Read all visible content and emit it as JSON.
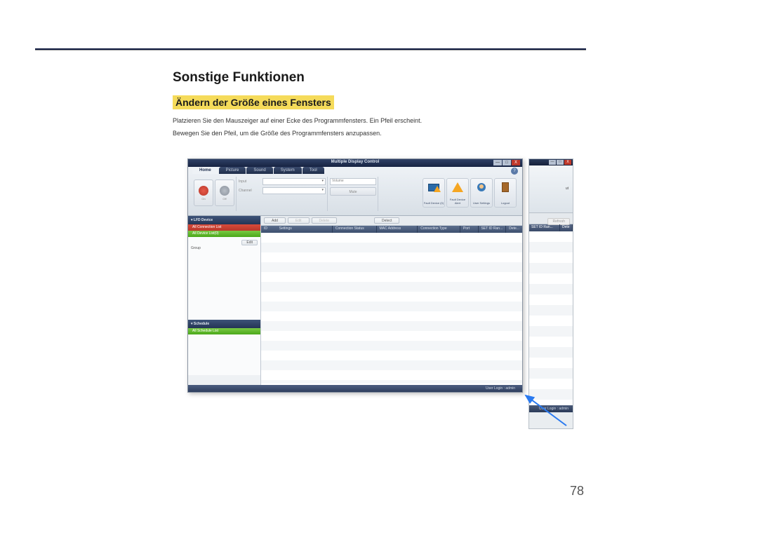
{
  "page": {
    "heading": "Sonstige Funktionen",
    "subheading": "Ändern der Größe eines Fensters",
    "para1": "Platzieren Sie den Mauszeiger auf einer Ecke des Programmfensters. Ein Pfeil erscheint.",
    "para2": "Bewegen Sie den Pfeil, um die Größe des Programmfensters anzupassen.",
    "number": "78"
  },
  "app": {
    "title": "Multiple Display Control",
    "tabs": {
      "home": "Home",
      "picture": "Picture",
      "sound": "Sound",
      "system": "System",
      "tool": "Tool"
    },
    "help": "?",
    "window_controls": {
      "min": "—",
      "max": "□",
      "close": "X"
    },
    "power": {
      "on": "On",
      "off": "Off"
    },
    "inputs": {
      "input_label": "Input",
      "channel_label": "Channel",
      "volume_label": "Volume",
      "mute": "Mute"
    },
    "toolbar": {
      "fault_device": "Fault Device (0)",
      "fault_alert": "Fault Device Alert",
      "user_settings": "User Settings",
      "logout": "Logout"
    },
    "sidebar": {
      "lfd_header": "LFD Device",
      "all_conn": "All Connection List",
      "all_device": "All Device List(0)",
      "group": "Group",
      "edit": "Edit",
      "schedule_header": "Schedule",
      "all_schedule": "All Schedule List"
    },
    "actions": {
      "add": "Add",
      "edit": "Edit",
      "delete": "Delete",
      "detect": "Detect",
      "refresh": "Refresh"
    },
    "columns": {
      "id": "ID",
      "settings": "Settings",
      "conn_status": "Connection Status",
      "mac": "MAC Address",
      "conn_type": "Connection Type",
      "port": "Port",
      "setid": "SET ID Ran...",
      "dete": "Dete..."
    },
    "columns_back": {
      "setid": "SET ID Ran...",
      "dete": "Dete"
    },
    "status": "User Login : admin",
    "status_back": "User Login : admin"
  }
}
